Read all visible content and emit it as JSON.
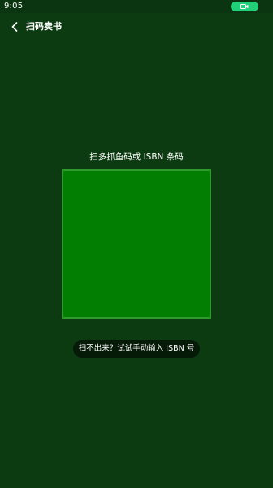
{
  "status_bar": {
    "time": "9:05",
    "pill_icon": "video-camera-icon",
    "pill_color": "#23d07a"
  },
  "header": {
    "back_icon": "chevron-left-icon",
    "title": "扫码卖书"
  },
  "scanner": {
    "hint": "扫多抓鱼码或 ISBN 条码",
    "frame_color": "#027f02"
  },
  "manual_entry": {
    "label": "扫不出来？试试手动输入 ISBN 号"
  },
  "colors": {
    "background": "#0c3a11",
    "accent": "#23d07a"
  }
}
